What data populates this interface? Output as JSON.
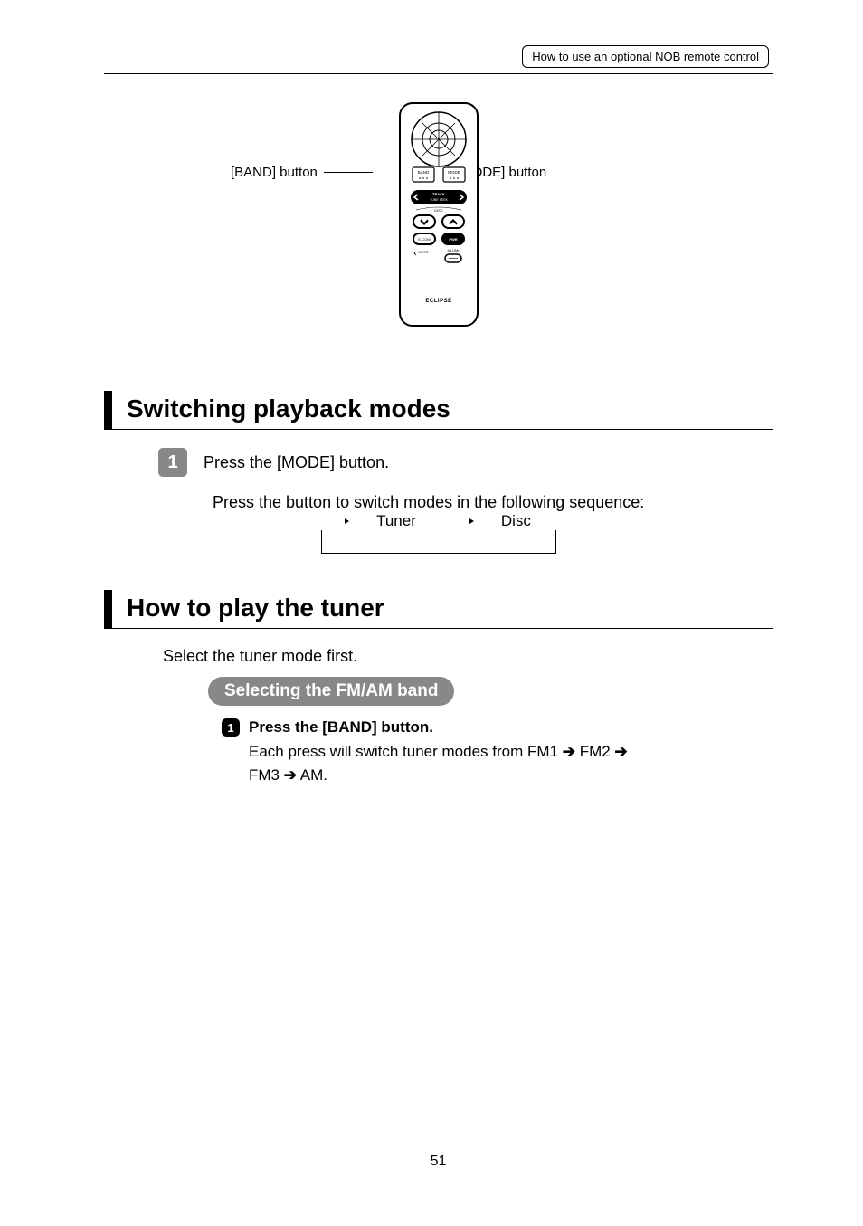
{
  "header": {
    "breadcrumb": "How to use an optional NOB remote control"
  },
  "remote": {
    "band_label": "[BAND] button",
    "mode_label": "[MODE] button",
    "buttons": {
      "band": "BAND",
      "mode": "MODE",
      "track": "TRACK",
      "tuneseek": "TUNE SEEK",
      "disc": "DISC",
      "ecom": "E-COM",
      "pwr": "PWR",
      "mute": "MUTE",
      "illumi": "ILLUMI",
      "brand": "ECLIPSE"
    }
  },
  "section1": {
    "heading": "Switching playback modes",
    "step": {
      "num": "1",
      "text": "Press the [MODE] button."
    },
    "para": "Press the button to switch modes in the following sequence:",
    "flow": {
      "a": "Tuner",
      "b": "Disc"
    }
  },
  "section2": {
    "heading": "How to play the tuner",
    "intro": "Select the tuner mode first.",
    "pill": "Selecting the FM/AM band",
    "substep": {
      "num": "1",
      "head": "Press the [BAND] button.",
      "body_pre": "Each press will switch tuner modes from FM1 ",
      "arrow1": "➔",
      "fm2": " FM2 ",
      "arrow2": "➔",
      "fm3_line": "FM3 ",
      "arrow3": "➔",
      "am": " AM."
    }
  },
  "page_number": "51"
}
